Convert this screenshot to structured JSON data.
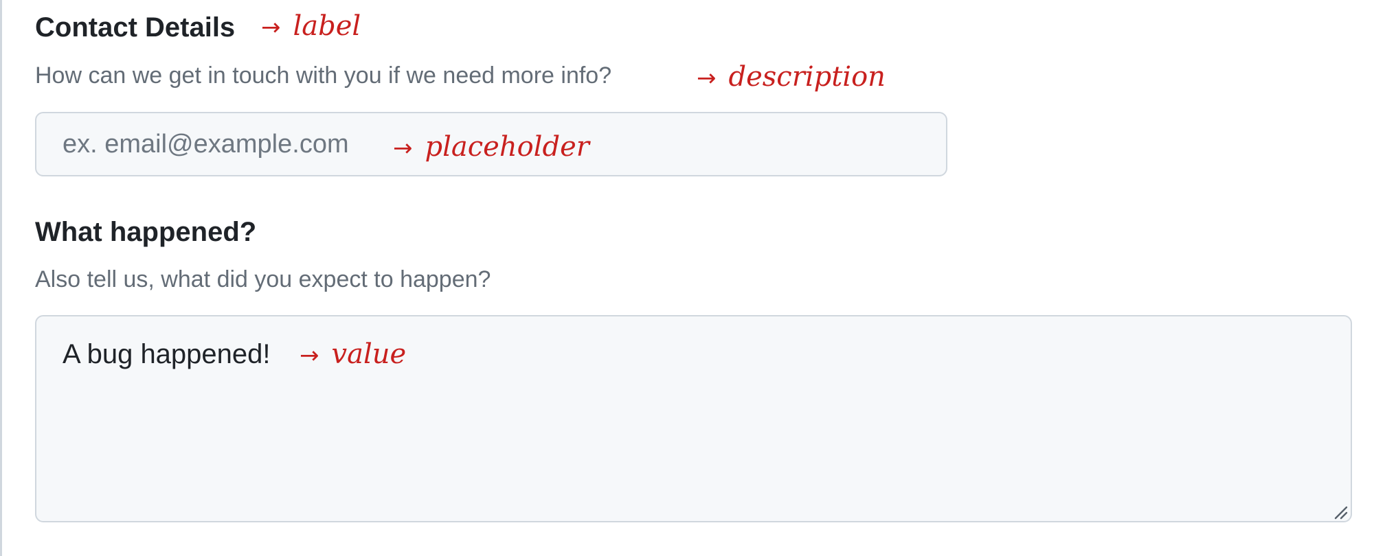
{
  "contact": {
    "label": "Contact Details",
    "description": "How can we get in touch with you if we need more info?",
    "placeholder": "ex. email@example.com",
    "value": ""
  },
  "what_happened": {
    "label": "What happened?",
    "description": "Also tell us, what did you expect to happen?",
    "value": "A bug happened!"
  },
  "annotations": {
    "arrow": "→",
    "label": "label",
    "description": "description",
    "placeholder": "placeholder",
    "value": "value"
  },
  "colors": {
    "label_text": "#1f2328",
    "description_text": "#636c76",
    "field_background": "#f6f8fa",
    "field_border": "#d0d7de",
    "annotation": "#c8201e"
  },
  "icons": {
    "resize_handle": "resize-handle-icon",
    "annotation_arrow": "arrow-right-icon"
  }
}
